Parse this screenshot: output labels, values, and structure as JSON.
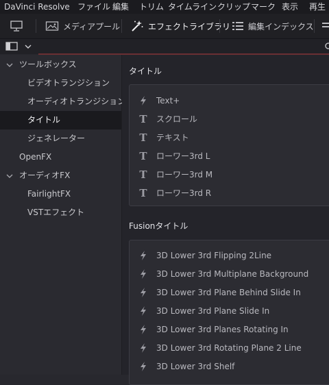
{
  "menubar": {
    "items": [
      "DaVinci Resolve",
      "ファイル",
      "編集",
      "トリム",
      "タイムライン",
      "クリップ",
      "マーク",
      "表示",
      "再生"
    ]
  },
  "toolbar": {
    "media_pool_label": "メディアプール",
    "effects_library_label": "エフェクトライブラリ",
    "edit_index_label": "編集インデックス"
  },
  "sidebar": {
    "items": [
      {
        "label": "ツールボックス",
        "expandable": true,
        "expanded": true
      },
      {
        "label": "ビデオトランジション"
      },
      {
        "label": "オーディオトランジション"
      },
      {
        "label": "タイトル",
        "selected": true
      },
      {
        "label": "ジェネレーター"
      },
      {
        "label": "OpenFX"
      },
      {
        "label": "オーディオFX",
        "expandable": true,
        "expanded": true
      },
      {
        "label": "FairlightFX"
      },
      {
        "label": "VSTエフェクト"
      }
    ]
  },
  "main": {
    "titles_section": {
      "title": "タイトル",
      "items": [
        {
          "label": "Text+",
          "icon": "lightning-icon"
        },
        {
          "label": "スクロール",
          "icon": "text-t-icon"
        },
        {
          "label": "テキスト",
          "icon": "text-t-icon"
        },
        {
          "label": "ローワー3rd L",
          "icon": "text-t-icon"
        },
        {
          "label": "ローワー3rd M",
          "icon": "text-t-icon"
        },
        {
          "label": "ローワー3rd R",
          "icon": "text-t-icon"
        }
      ]
    },
    "fusion_section": {
      "title": "Fusionタイトル",
      "items": [
        {
          "label": "3D Lower 3rd Flipping 2Line",
          "icon": "lightning-icon"
        },
        {
          "label": "3D Lower 3rd Multiplane Background",
          "icon": "lightning-icon"
        },
        {
          "label": "3D Lower 3rd Plane Behind Slide In",
          "icon": "lightning-icon"
        },
        {
          "label": "3D Lower 3rd Plane Slide In",
          "icon": "lightning-icon"
        },
        {
          "label": "3D Lower 3rd Planes Rotating In",
          "icon": "lightning-icon"
        },
        {
          "label": "3D Lower 3rd Rotating Plane 2 Line",
          "icon": "lightning-icon"
        },
        {
          "label": "3D Lower 3rd Shelf",
          "icon": "lightning-icon"
        }
      ]
    }
  },
  "colors": {
    "accent": "#6b2f33",
    "selected_bg": "#1a1a1e"
  }
}
